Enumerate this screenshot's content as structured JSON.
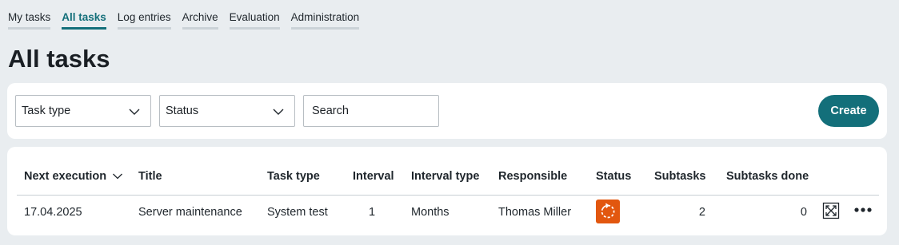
{
  "nav": {
    "tabs": [
      {
        "label": "My tasks",
        "active": false
      },
      {
        "label": "All tasks",
        "active": true
      },
      {
        "label": "Log entries",
        "active": false
      },
      {
        "label": "Archive",
        "active": false
      },
      {
        "label": "Evaluation",
        "active": false
      },
      {
        "label": "Administration",
        "active": false
      }
    ]
  },
  "page": {
    "title": "All tasks"
  },
  "filters": {
    "task_type_label": "Task type",
    "status_label": "Status",
    "search_placeholder": "Search",
    "create_label": "Create"
  },
  "table": {
    "columns": [
      "Next execution",
      "Title",
      "Task type",
      "Interval",
      "Interval type",
      "Responsible",
      "Status",
      "Subtasks",
      "Subtasks done"
    ],
    "sort_column": "Next execution",
    "rows": [
      {
        "next_execution": "17.04.2025",
        "title": "Server maintenance",
        "task_type": "System test",
        "interval": "1",
        "interval_type": "Months",
        "responsible": "Thomas Miller",
        "status_icon": "refresh-icon",
        "subtasks": "2",
        "subtasks_done": "0"
      }
    ]
  },
  "colors": {
    "accent": "#136f7a",
    "status_orange": "#e2570f",
    "background": "#e9edf0"
  }
}
